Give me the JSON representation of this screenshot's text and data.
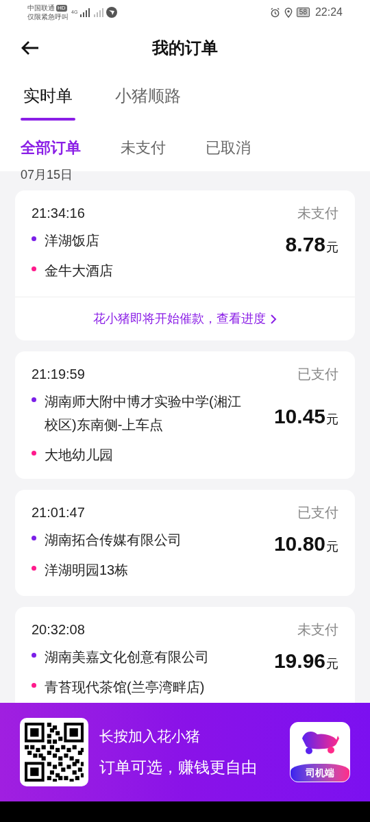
{
  "status_bar": {
    "carrier": "中国联通",
    "hd": "HD",
    "emergency": "仅限紧急呼叫",
    "network": "4G",
    "battery": "58",
    "time": "22:24"
  },
  "header": {
    "title": "我的订单"
  },
  "tabs": [
    {
      "label": "实时单",
      "selected": true
    },
    {
      "label": "小猪顺路",
      "selected": false
    }
  ],
  "filters": [
    {
      "label": "全部订单",
      "selected": true
    },
    {
      "label": "未支付",
      "selected": false
    },
    {
      "label": "已取消",
      "selected": false
    }
  ],
  "date": "07月15日",
  "orders": [
    {
      "time": "21:34:16",
      "status": "未支付",
      "stops": [
        {
          "kind": "start",
          "name": "洋湖饭店"
        },
        {
          "kind": "end",
          "name": "金牛大酒店"
        }
      ],
      "amount": "8.78",
      "unit": "元",
      "notice": "花小猪即将开始催款，查看进度"
    },
    {
      "time": "21:19:59",
      "status": "已支付",
      "stops": [
        {
          "kind": "start",
          "name": "湖南师大附中博才实验中学(湘江校区)东南侧-上车点"
        },
        {
          "kind": "end",
          "name": "大地幼儿园"
        }
      ],
      "amount": "10.45",
      "unit": "元"
    },
    {
      "time": "21:01:47",
      "status": "已支付",
      "stops": [
        {
          "kind": "start",
          "name": "湖南拓合传媒有限公司"
        },
        {
          "kind": "end",
          "name": "洋湖明园13栋"
        }
      ],
      "amount": "10.80",
      "unit": "元"
    },
    {
      "time": "20:32:08",
      "status": "未支付",
      "stops": [
        {
          "kind": "start",
          "name": "湖南美嘉文化创意有限公司"
        },
        {
          "kind": "end",
          "name": "青苔现代茶馆(兰亭湾畔店)"
        }
      ],
      "amount": "19.96",
      "unit": "元"
    }
  ],
  "banner": {
    "line_1": "长按加入花小猪",
    "line_2": "订单可选，赚钱更自由",
    "app_label": "司机端"
  }
}
